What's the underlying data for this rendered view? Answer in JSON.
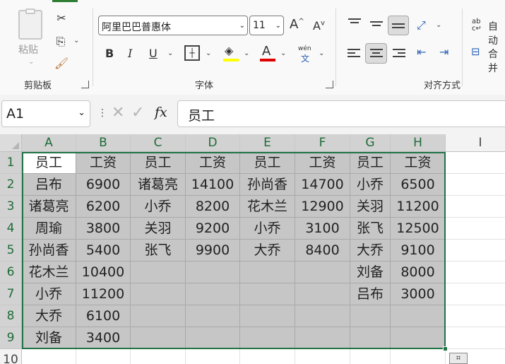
{
  "ribbon": {
    "clipboard": {
      "paste_label": "粘贴",
      "group_label": "剪贴板"
    },
    "font": {
      "font_name": "阿里巴巴普惠体",
      "font_size": "11",
      "bold": "B",
      "italic": "I",
      "underline": "U",
      "font_color_label": "A",
      "phonetic_top": "wén",
      "phonetic_bottom": "文",
      "group_label": "字体",
      "highlight_color": "#ffff00",
      "font_color": "#e00000"
    },
    "alignment": {
      "group_label": "对齐方式",
      "wrap_label": "自动",
      "merge_label": "合并"
    }
  },
  "formula_bar": {
    "name_box": "A1",
    "fx": "fx",
    "formula": "员工"
  },
  "columns": [
    "A",
    "B",
    "C",
    "D",
    "E",
    "F",
    "G",
    "H",
    "I"
  ],
  "rows": [
    "1",
    "2",
    "3",
    "4",
    "5",
    "6",
    "7",
    "8",
    "9",
    "10"
  ],
  "cells": [
    [
      "员工",
      "工资",
      "员工",
      "工资",
      "员工",
      "工资",
      "员工",
      "工资"
    ],
    [
      "吕布",
      "6900",
      "诸葛亮",
      "14100",
      "孙尚香",
      "14700",
      "小乔",
      "6500"
    ],
    [
      "诸葛亮",
      "6200",
      "小乔",
      "8200",
      "花木兰",
      "12900",
      "关羽",
      "11200"
    ],
    [
      "周瑜",
      "3800",
      "关羽",
      "9200",
      "小乔",
      "3100",
      "张飞",
      "12500"
    ],
    [
      "孙尚香",
      "5400",
      "张飞",
      "9900",
      "大乔",
      "8400",
      "大乔",
      "9100"
    ],
    [
      "花木兰",
      "10400",
      "",
      "",
      "",
      "",
      "刘备",
      "8000"
    ],
    [
      "小乔",
      "11200",
      "",
      "",
      "",
      "",
      "吕布",
      "3000"
    ],
    [
      "大乔",
      "6100",
      "",
      "",
      "",
      "",
      "",
      ""
    ],
    [
      "刘备",
      "3400",
      "",
      "",
      "",
      "",
      "",
      ""
    ]
  ],
  "colors": {
    "selection_border": "#217346",
    "selected_fill": "#c6c6c6",
    "header_selected_text": "#1e6b37"
  }
}
